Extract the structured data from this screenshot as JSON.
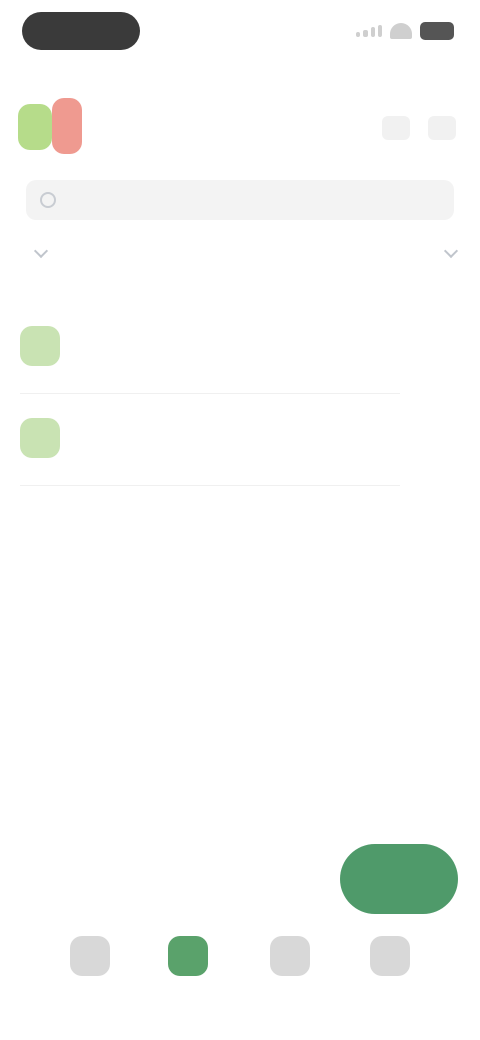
{
  "status_bar": {
    "time": "",
    "signal_icon": "signal-icon",
    "wifi_icon": "wifi-icon",
    "battery_icon": "battery-icon"
  },
  "header": {
    "title": "",
    "actions": [
      {
        "icon": "search-icon"
      },
      {
        "icon": "more-icon"
      }
    ]
  },
  "search": {
    "placeholder": ""
  },
  "filters": {
    "left_label": "",
    "right_label": ""
  },
  "list": {
    "items": [
      {
        "title": "",
        "subtitle": ""
      },
      {
        "title": "",
        "subtitle": ""
      }
    ]
  },
  "bottom_actions": {
    "link_label": "",
    "primary_label": ""
  },
  "bottom_nav": {
    "items": [
      {
        "label": "",
        "icon": "home-icon"
      },
      {
        "label": "",
        "icon": "list-icon"
      },
      {
        "label": "",
        "icon": "bell-icon"
      },
      {
        "label": "",
        "icon": "profile-icon"
      }
    ],
    "active_index": 1
  },
  "colors": {
    "accent": "#4f9a6a",
    "accent_light": "#c9e3b3",
    "logo_red": "#ef9a90",
    "logo_green": "#b6dc8a"
  }
}
